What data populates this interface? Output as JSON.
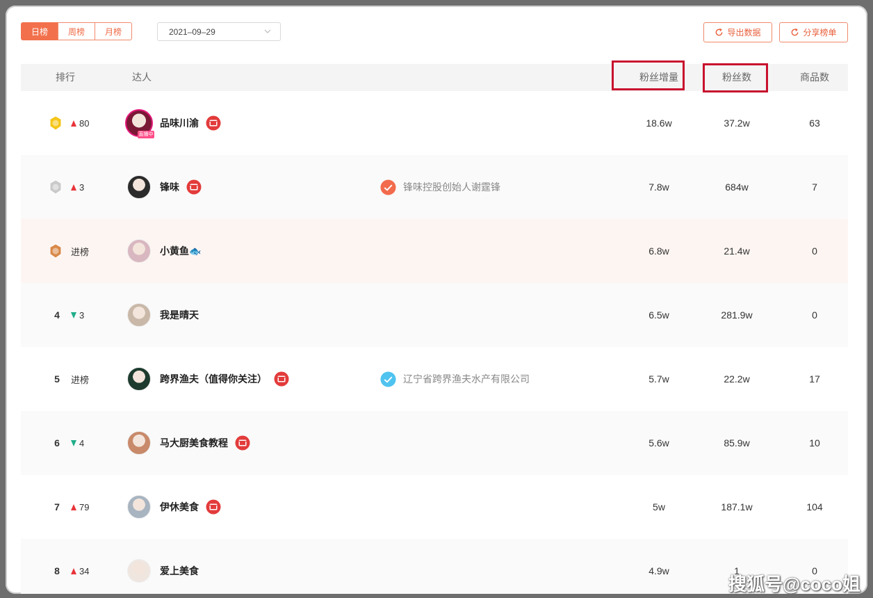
{
  "toolbar": {
    "tabs": [
      {
        "label": "日榜",
        "active": true
      },
      {
        "label": "周榜",
        "active": false
      },
      {
        "label": "月榜",
        "active": false
      }
    ],
    "date_value": "2021–09–29",
    "export_label": "导出数据",
    "share_label": "分享榜单"
  },
  "table": {
    "headers": {
      "rank": "排行",
      "influencer": "达人",
      "fan_growth": "粉丝增量",
      "fans": "粉丝数",
      "products": "商品数"
    },
    "rows": [
      {
        "rank": "",
        "medal": "gold",
        "change_dir": "up",
        "change": "80",
        "name": "品味川渝",
        "shop": true,
        "live": true,
        "live_label": "直播中",
        "verify_text": "",
        "fan_growth": "18.6w",
        "fans": "37.2w",
        "products": "63"
      },
      {
        "rank": "",
        "medal": "silver",
        "change_dir": "up",
        "change": "3",
        "name": "锋味",
        "shop": true,
        "live": false,
        "verify_text": "锋味控股创始人谢霆锋",
        "verify_color": "#f26b4c",
        "fan_growth": "7.8w",
        "fans": "684w",
        "products": "7"
      },
      {
        "rank": "",
        "medal": "bronze",
        "change_dir": "new",
        "change": "进榜",
        "name": "小黄鱼🐟",
        "shop": false,
        "live": false,
        "verify_text": "",
        "fan_growth": "6.8w",
        "fans": "21.4w",
        "products": "0"
      },
      {
        "rank": "4",
        "medal": "",
        "change_dir": "down",
        "change": "3",
        "name": "我是晴天",
        "shop": false,
        "live": false,
        "verify_text": "",
        "fan_growth": "6.5w",
        "fans": "281.9w",
        "products": "0"
      },
      {
        "rank": "5",
        "medal": "",
        "change_dir": "new",
        "change": "进榜",
        "name": "跨界渔夫（值得你关注）",
        "shop": true,
        "live": false,
        "verify_text": "辽宁省跨界渔夫水产有限公司",
        "verify_color": "#4fc3f0",
        "fan_growth": "5.7w",
        "fans": "22.2w",
        "products": "17"
      },
      {
        "rank": "6",
        "medal": "",
        "change_dir": "down",
        "change": "4",
        "name": "马大厨美食教程",
        "shop": true,
        "live": false,
        "verify_text": "",
        "fan_growth": "5.6w",
        "fans": "85.9w",
        "products": "10"
      },
      {
        "rank": "7",
        "medal": "",
        "change_dir": "up",
        "change": "79",
        "name": "伊休美食",
        "shop": true,
        "live": false,
        "verify_text": "",
        "fan_growth": "5w",
        "fans": "187.1w",
        "products": "104"
      },
      {
        "rank": "8",
        "medal": "",
        "change_dir": "up",
        "change": "34",
        "name": "爱上美食",
        "shop": false,
        "live": false,
        "verify_text": "",
        "fan_growth": "4.9w",
        "fans": "1",
        "products": "0"
      }
    ]
  },
  "watermark": "搜狐号@coco姐",
  "colors": {
    "accent": "#f2714c",
    "highlight_box": "#c8102e",
    "up": "#e8343a",
    "down": "#1fae8a",
    "gold": "#f5c518",
    "silver": "#c9c9c9",
    "bronze": "#d9894a"
  }
}
